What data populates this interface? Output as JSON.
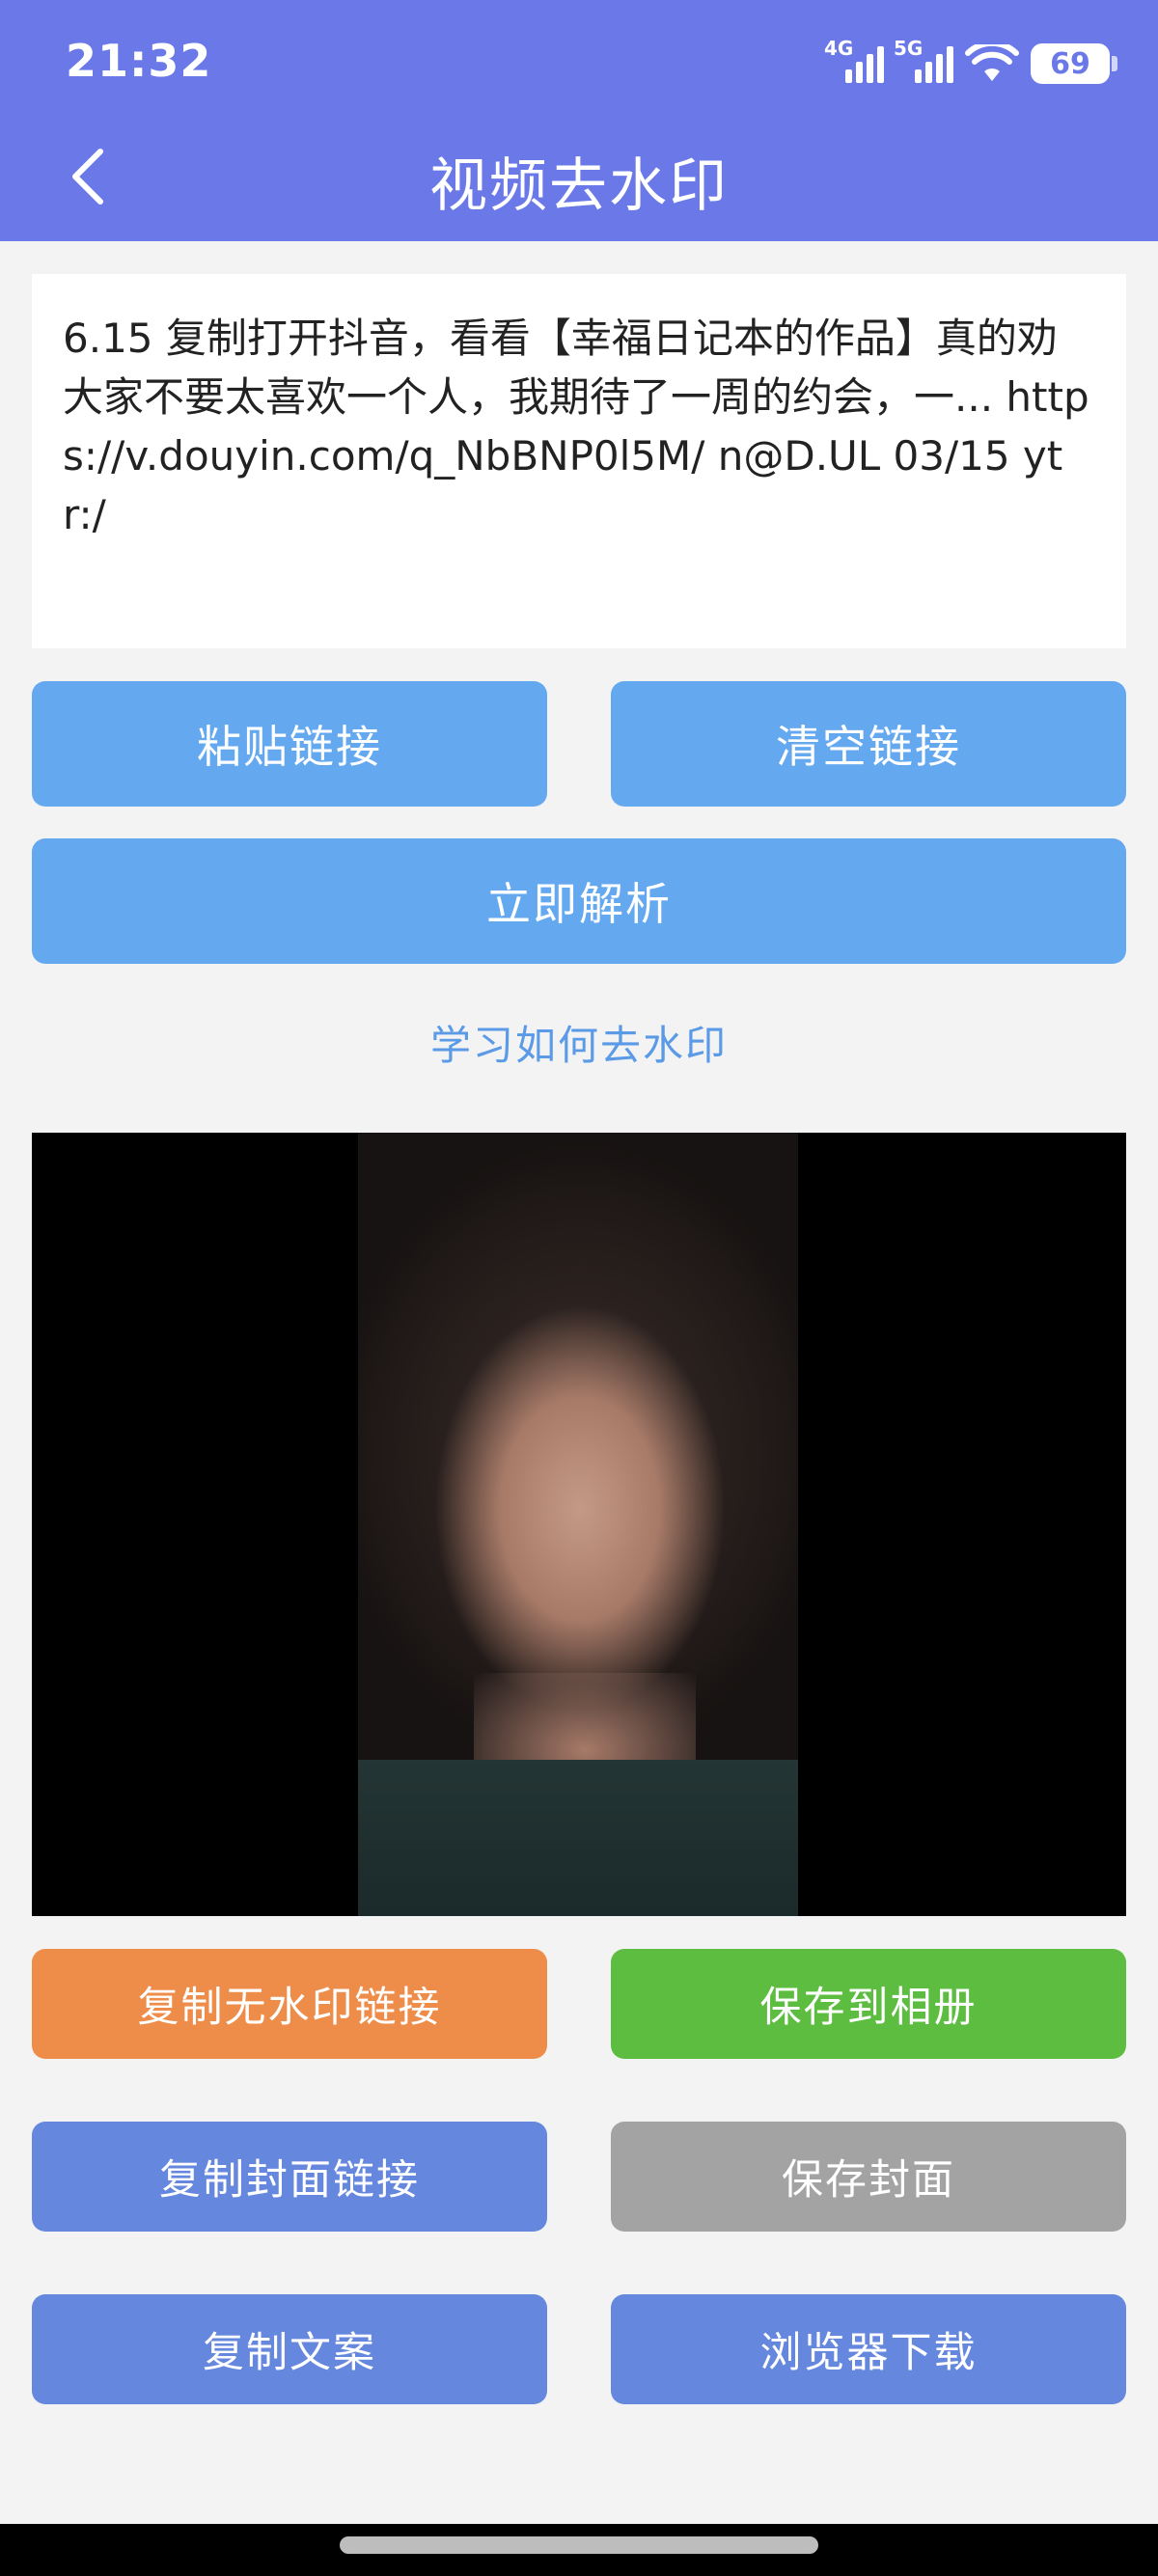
{
  "status_bar": {
    "time": "21:32",
    "network_1": "4G",
    "network_2": "5G",
    "battery": "69"
  },
  "header": {
    "title": "视频去水印",
    "back_icon": "chevron-left-icon"
  },
  "link_input": {
    "value": "6.15 复制打开抖音，看看【幸福日记本的作品】真的劝大家不要太喜欢一个人，我期待了一周的约会，一... https://v.douyin.com/q_NbBNP0l5M/ n@D.UL 03/15 ytr:/"
  },
  "buttons": {
    "paste": "粘贴链接",
    "clear": "清空链接",
    "parse": "立即解析",
    "copy_no_watermark": "复制无水印链接",
    "save_album": "保存到相册",
    "copy_cover_link": "复制封面链接",
    "save_cover": "保存封面",
    "copy_text": "复制文案",
    "browser_download": "浏览器下载"
  },
  "learn_link": "学习如何去水印",
  "colors": {
    "header": "#6a78e8",
    "blue": "#64a8f0",
    "orange": "#ee8d4a",
    "green": "#5dbd40",
    "indigo": "#6588de",
    "gray": "#a3a3a3"
  }
}
